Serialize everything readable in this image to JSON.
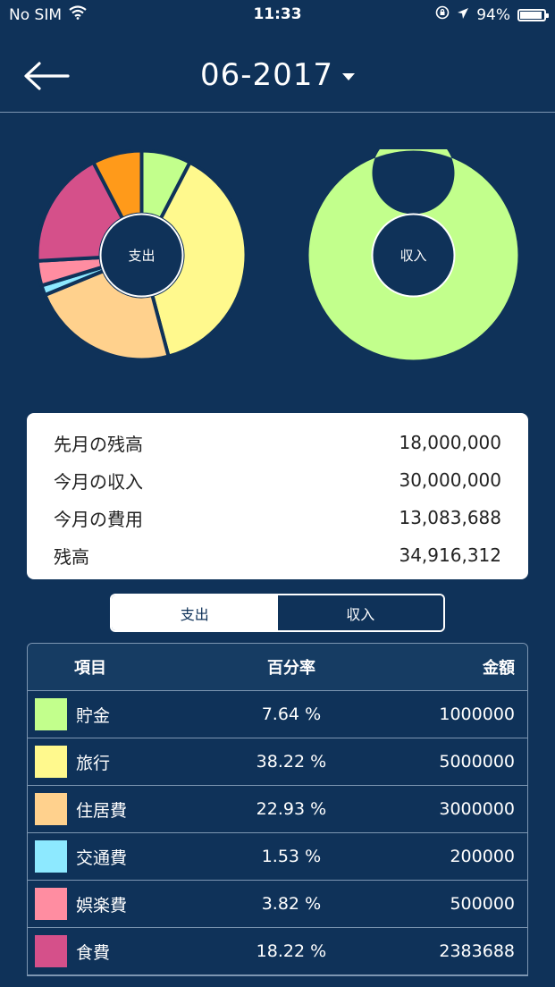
{
  "status": {
    "carrier": "No SIM",
    "time": "11:33",
    "battery": "94%",
    "battery_level": 0.94
  },
  "nav": {
    "title": "06-2017"
  },
  "charts": {
    "expense_label": "支出",
    "income_label": "収入"
  },
  "summary": {
    "rows": [
      {
        "label": "先月の残高",
        "value": "18,000,000"
      },
      {
        "label": "今月の収入",
        "value": "30,000,000"
      },
      {
        "label": "今月の費用",
        "value": "13,083,688"
      },
      {
        "label": "残高",
        "value": "34,916,312"
      }
    ]
  },
  "segment": {
    "expense": "支出",
    "income": "収入"
  },
  "table": {
    "headers": {
      "item": "項目",
      "percent": "百分率",
      "amount": "金額"
    },
    "rows": [
      {
        "name": "貯金",
        "percent": "7.64 %",
        "amount": "1000000",
        "color": "#c2ff8c"
      },
      {
        "name": "旅行",
        "percent": "38.22 %",
        "amount": "5000000",
        "color": "#fff98d"
      },
      {
        "name": "住居費",
        "percent": "22.93 %",
        "amount": "3000000",
        "color": "#ffd18d"
      },
      {
        "name": "交通費",
        "percent": "1.53 %",
        "amount": "200000",
        "color": "#8de9ff"
      },
      {
        "name": "娯楽費",
        "percent": "3.82 %",
        "amount": "500000",
        "color": "#ff8da1"
      },
      {
        "name": "食費",
        "percent": "18.22 %",
        "amount": "2383688",
        "color": "#d5508a"
      }
    ]
  },
  "chart_data": [
    {
      "type": "pie",
      "center_label": "支出",
      "categories": [
        "貯金",
        "旅行",
        "住居費",
        "交通費",
        "娯楽費",
        "食費",
        ""
      ],
      "values": [
        7.64,
        38.22,
        22.93,
        1.53,
        3.82,
        18.22,
        7.64
      ],
      "colors": [
        "#c2ff8c",
        "#fff98d",
        "#ffd18d",
        "#8de9ff",
        "#ff8da1",
        "#d5508a",
        "#ff9a1a"
      ]
    },
    {
      "type": "pie",
      "center_label": "収入",
      "categories": [
        ""
      ],
      "values": [
        100
      ],
      "colors": [
        "#c2ff8c"
      ]
    }
  ]
}
